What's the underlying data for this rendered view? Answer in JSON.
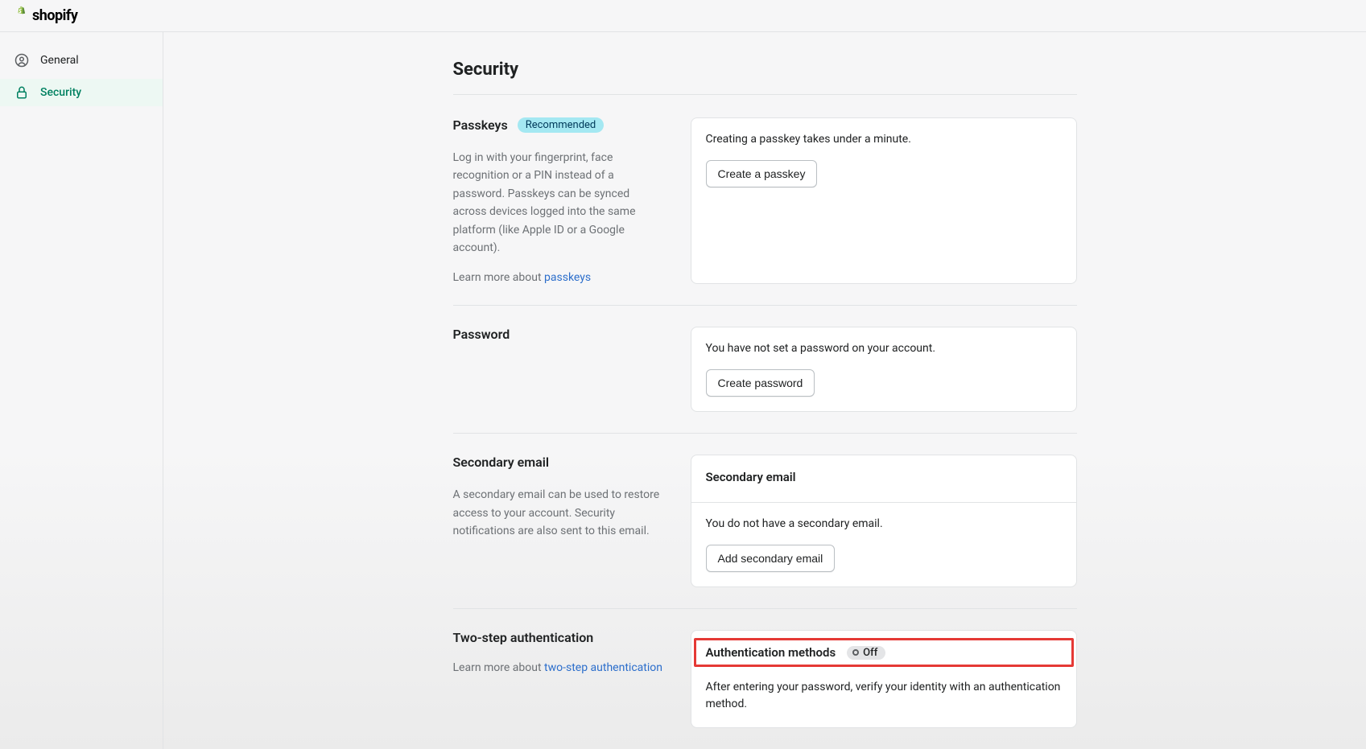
{
  "header": {
    "brand": "shopify"
  },
  "sidebar": {
    "items": [
      {
        "label": "General"
      },
      {
        "label": "Security"
      }
    ]
  },
  "page": {
    "title": "Security"
  },
  "passkeys": {
    "title": "Passkeys",
    "badge": "Recommended",
    "desc": "Log in with your fingerprint, face recognition or a PIN instead of a password. Passkeys can be synced across devices logged into the same platform (like Apple ID or a Google account).",
    "learn_prefix": "Learn more about ",
    "learn_link": "passkeys",
    "card_text": "Creating a passkey takes under a minute.",
    "button": "Create a passkey"
  },
  "password": {
    "title": "Password",
    "card_text": "You have not set a password on your account.",
    "button": "Create password"
  },
  "secondary_email": {
    "title": "Secondary email",
    "desc": "A secondary email can be used to restore access to your account. Security notifications are also sent to this email.",
    "card_heading": "Secondary email",
    "card_text": "You do not have a secondary email.",
    "button": "Add secondary email"
  },
  "two_step": {
    "title": "Two-step authentication",
    "learn_prefix": "Learn more about ",
    "learn_link": "two-step authentication",
    "card_heading": "Authentication methods",
    "status": "Off",
    "card_text": "After entering your password, verify your identity with an authentication method."
  }
}
